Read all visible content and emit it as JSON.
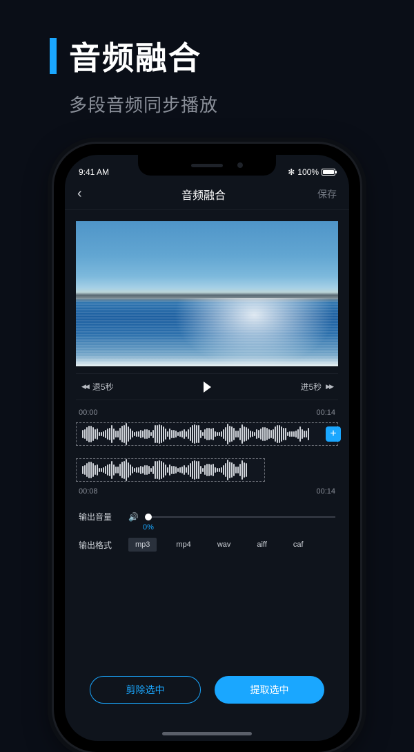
{
  "promo": {
    "title": "音频融合",
    "subtitle": "多段音频同步播放"
  },
  "status": {
    "time": "9:41 AM",
    "battery_pct": "100%",
    "bt_glyph": "✻"
  },
  "nav": {
    "back_glyph": "‹",
    "title": "音频融合",
    "save": "保存"
  },
  "transport": {
    "rewind_label": "退5秒",
    "rewind_glyph": "◀◀",
    "forward_label": "进5秒",
    "forward_glyph": "▶▶"
  },
  "track1": {
    "start": "00:00",
    "end": "00:14",
    "add_glyph": "+"
  },
  "track2": {
    "start": "00:08",
    "end": "00:14"
  },
  "volume": {
    "label": "输出音量",
    "icon": "🔊",
    "pct": "0%"
  },
  "format": {
    "label": "输出格式",
    "options": [
      "mp3",
      "mp4",
      "wav",
      "aiff",
      "caf"
    ],
    "selected": "mp3"
  },
  "actions": {
    "cut": "剪除选中",
    "extract": "提取选中"
  }
}
